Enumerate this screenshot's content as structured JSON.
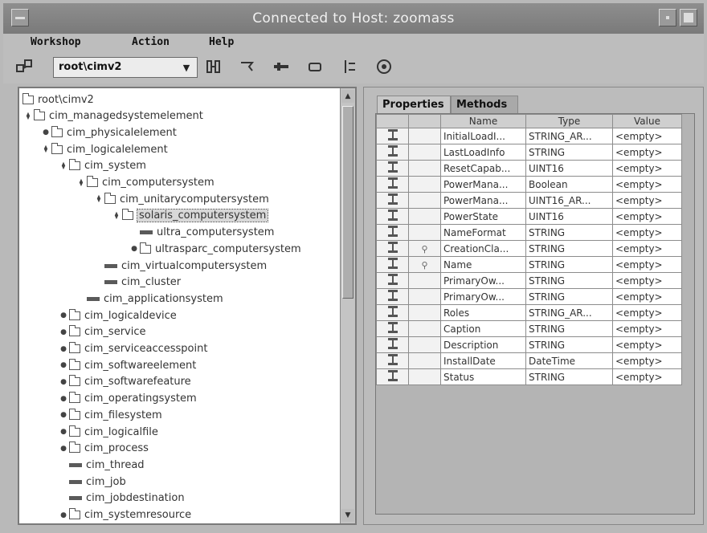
{
  "window": {
    "title": "Connected to Host: zoomass"
  },
  "menu": [
    "Workshop",
    "Action",
    "Help"
  ],
  "toolbar": {
    "namespace": "root\\cimv2",
    "icons": [
      "hierarchy-icon",
      "new-class-icon",
      "filter-icon",
      "remove-icon",
      "instance-icon",
      "sort-icon",
      "event-icon"
    ]
  },
  "tree": [
    {
      "label": "root\\cimv2",
      "level": 0,
      "kind": "folder",
      "exp": "none"
    },
    {
      "label": "cim_managedsystemelement",
      "level": 0,
      "kind": "folder",
      "exp": "open"
    },
    {
      "label": "cim_physicalelement",
      "level": 1,
      "kind": "folder",
      "exp": "closed"
    },
    {
      "label": "cim_logicalelement",
      "level": 1,
      "kind": "folder",
      "exp": "open"
    },
    {
      "label": "cim_system",
      "level": 2,
      "kind": "folder",
      "exp": "open"
    },
    {
      "label": "cim_computersystem",
      "level": 3,
      "kind": "folder",
      "exp": "open"
    },
    {
      "label": "cim_unitarycomputersystem",
      "level": 4,
      "kind": "folder",
      "exp": "open"
    },
    {
      "label": "solaris_computersystem",
      "level": 5,
      "kind": "folder",
      "exp": "open",
      "selected": true
    },
    {
      "label": "ultra_computersystem",
      "level": 6,
      "kind": "leaf",
      "exp": "none"
    },
    {
      "label": "ultrasparc_computersystem",
      "level": 6,
      "kind": "folder",
      "exp": "closed"
    },
    {
      "label": "cim_virtualcomputersystem",
      "level": 4,
      "kind": "leaf",
      "exp": "none"
    },
    {
      "label": "cim_cluster",
      "level": 4,
      "kind": "leaf",
      "exp": "none"
    },
    {
      "label": "cim_applicationsystem",
      "level": 3,
      "kind": "leaf",
      "exp": "none"
    },
    {
      "label": "cim_logicaldevice",
      "level": 2,
      "kind": "folder",
      "exp": "closed"
    },
    {
      "label": "cim_service",
      "level": 2,
      "kind": "folder",
      "exp": "closed"
    },
    {
      "label": "cim_serviceaccesspoint",
      "level": 2,
      "kind": "folder",
      "exp": "closed"
    },
    {
      "label": "cim_softwareelement",
      "level": 2,
      "kind": "folder",
      "exp": "closed"
    },
    {
      "label": "cim_softwarefeature",
      "level": 2,
      "kind": "folder",
      "exp": "closed"
    },
    {
      "label": "cim_operatingsystem",
      "level": 2,
      "kind": "folder",
      "exp": "closed"
    },
    {
      "label": "cim_filesystem",
      "level": 2,
      "kind": "folder",
      "exp": "closed"
    },
    {
      "label": "cim_logicalfile",
      "level": 2,
      "kind": "folder",
      "exp": "closed"
    },
    {
      "label": "cim_process",
      "level": 2,
      "kind": "folder",
      "exp": "closed"
    },
    {
      "label": "cim_thread",
      "level": 2,
      "kind": "leaf",
      "exp": "none"
    },
    {
      "label": "cim_job",
      "level": 2,
      "kind": "leaf",
      "exp": "none"
    },
    {
      "label": "cim_jobdestination",
      "level": 2,
      "kind": "leaf",
      "exp": "none"
    },
    {
      "label": "cim_systemresource",
      "level": 2,
      "kind": "folder",
      "exp": "closed"
    }
  ],
  "tabs": {
    "properties": "Properties",
    "methods": "Methods"
  },
  "table": {
    "headers": [
      "Name",
      "Type",
      "Value"
    ],
    "rows": [
      {
        "key": false,
        "name": "InitialLoadI...",
        "type": "STRING_AR...",
        "value": "<empty>"
      },
      {
        "key": false,
        "name": "LastLoadInfo",
        "type": "STRING",
        "value": "<empty>"
      },
      {
        "key": false,
        "name": "ResetCapab...",
        "type": "UINT16",
        "value": "<empty>"
      },
      {
        "key": false,
        "name": "PowerMana...",
        "type": "Boolean",
        "value": "<empty>"
      },
      {
        "key": false,
        "name": "PowerMana...",
        "type": "UINT16_AR...",
        "value": "<empty>"
      },
      {
        "key": false,
        "name": "PowerState",
        "type": "UINT16",
        "value": "<empty>"
      },
      {
        "key": false,
        "name": "NameFormat",
        "type": "STRING",
        "value": "<empty>"
      },
      {
        "key": true,
        "name": "CreationCla...",
        "type": "STRING",
        "value": "<empty>"
      },
      {
        "key": true,
        "name": "Name",
        "type": "STRING",
        "value": "<empty>"
      },
      {
        "key": false,
        "name": "PrimaryOw...",
        "type": "STRING",
        "value": "<empty>"
      },
      {
        "key": false,
        "name": "PrimaryOw...",
        "type": "STRING",
        "value": "<empty>"
      },
      {
        "key": false,
        "name": "Roles",
        "type": "STRING_AR...",
        "value": "<empty>"
      },
      {
        "key": false,
        "name": "Caption",
        "type": "STRING",
        "value": "<empty>"
      },
      {
        "key": false,
        "name": "Description",
        "type": "STRING",
        "value": "<empty>"
      },
      {
        "key": false,
        "name": "InstallDate",
        "type": "DateTime",
        "value": "<empty>"
      },
      {
        "key": false,
        "name": "Status",
        "type": "STRING",
        "value": "<empty>"
      }
    ]
  }
}
